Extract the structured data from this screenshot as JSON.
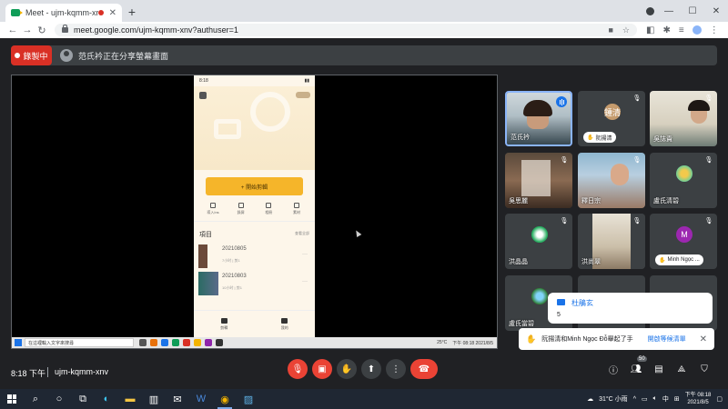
{
  "browser": {
    "tab_title": "Meet - ujm-kqmm-xnv",
    "url": "meet.google.com/ujm-kqmm-xnv?authuser=1"
  },
  "recording": {
    "badge": "錄製中",
    "presenting_text": "范氏衿正在分享螢幕畫面"
  },
  "phone": {
    "time": "8:18",
    "primary_button": "+ 開始剪輯",
    "tools": [
      "導入Ins",
      "錄屏",
      "相冊",
      "素材"
    ],
    "projects_title": "項目",
    "projects_more": "查看全部",
    "projects": [
      {
        "name": "20210805",
        "meta": "7小时 | 剪1"
      },
      {
        "name": "20210803",
        "meta": "10小时 | 剪1"
      }
    ],
    "nav": [
      "剪輯",
      "我的"
    ]
  },
  "inner_taskbar": {
    "search": "在這裡輸入文字來搜尋",
    "weather": "25°C",
    "clock": "下午 08:18 2021/8/5"
  },
  "participants": [
    {
      "name": "范氏衿",
      "type": "video",
      "speaking": true
    },
    {
      "name": "鍾清",
      "type": "avatar",
      "initial": "鍾清",
      "hand": "阮揚清"
    },
    {
      "name": "吳誌貴",
      "type": "video"
    },
    {
      "name": "吳思麗",
      "type": "video"
    },
    {
      "name": "釋日宗",
      "type": "video"
    },
    {
      "name": "盧氏清碧",
      "type": "avatar",
      "initial": ""
    },
    {
      "name": "洪晶晶",
      "type": "avatar",
      "initial": ""
    },
    {
      "name": "洪尚翠",
      "type": "video"
    },
    {
      "name": "Minh Ngọc",
      "type": "avatar",
      "initial": "M",
      "hand": "Minh Ngọc ..."
    },
    {
      "name": "盧氏當碧",
      "type": "avatar",
      "initial": ""
    }
  ],
  "chat_toast": {
    "sender": "杜鵑玄",
    "message": "5"
  },
  "hand_toast": {
    "text": "阮揚清和Minh Ngọc Đỗ舉起了手",
    "action": "開啟等候清單"
  },
  "controls": {
    "time": "8:18 下午",
    "meeting_code": "ujm-kqmm-xnv",
    "people_count": "50"
  },
  "taskbar": {
    "weather": "31°C 小雨",
    "ime": "中",
    "time": "下午 08:18",
    "date": "2021/8/5"
  }
}
